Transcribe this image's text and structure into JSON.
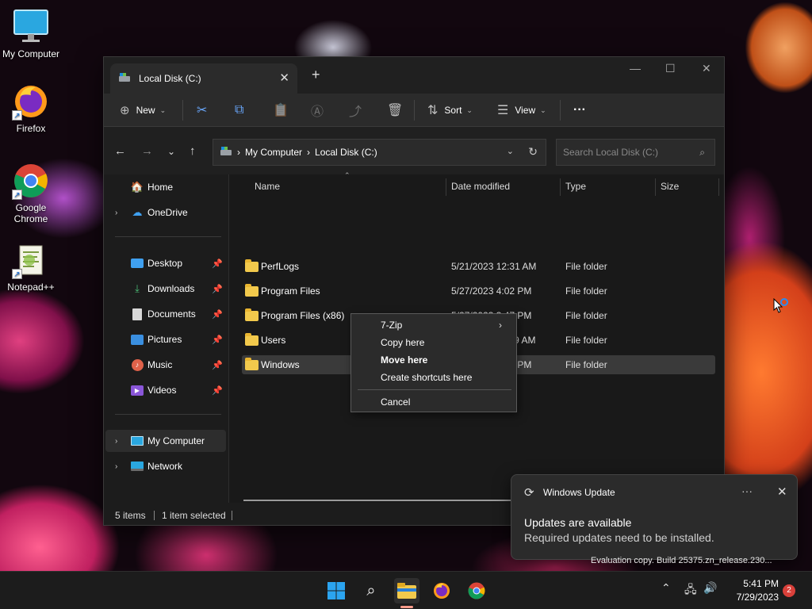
{
  "desktop": {
    "icons": [
      {
        "label": "My Computer",
        "icon": "monitor-icon"
      },
      {
        "label": "Firefox",
        "icon": "firefox-icon"
      },
      {
        "label": "Google Chrome",
        "icon": "chrome-icon"
      },
      {
        "label": "Notepad++",
        "icon": "notepadpp-icon"
      }
    ],
    "watermark": "Evaluation copy. Build 25375.zn_release.230..."
  },
  "explorer": {
    "tab_title": "Local Disk (C:)",
    "toolbar": {
      "new": "New",
      "sort": "Sort",
      "view": "View",
      "more": "···"
    },
    "address": {
      "root": "My Computer",
      "current": "Local Disk (C:)"
    },
    "search_placeholder": "Search Local Disk (C:)",
    "sidebar": [
      {
        "label": "Home",
        "icon": "home-icon",
        "chevron": false,
        "pinned": false
      },
      {
        "label": "OneDrive",
        "icon": "cloud-icon",
        "chevron": true,
        "pinned": false
      },
      {
        "label": "Desktop",
        "icon": "desktop-icon",
        "chevron": false,
        "pinned": true
      },
      {
        "label": "Downloads",
        "icon": "download-icon",
        "chevron": false,
        "pinned": true
      },
      {
        "label": "Documents",
        "icon": "document-icon",
        "chevron": false,
        "pinned": true
      },
      {
        "label": "Pictures",
        "icon": "picture-icon",
        "chevron": false,
        "pinned": true
      },
      {
        "label": "Music",
        "icon": "music-icon",
        "chevron": false,
        "pinned": true
      },
      {
        "label": "Videos",
        "icon": "video-icon",
        "chevron": false,
        "pinned": true
      },
      {
        "label": "My Computer",
        "icon": "computer-icon",
        "chevron": true,
        "pinned": false,
        "selected": true
      },
      {
        "label": "Network",
        "icon": "network-icon",
        "chevron": true,
        "pinned": false
      }
    ],
    "columns": [
      "Name",
      "Date modified",
      "Type",
      "Size"
    ],
    "files": [
      {
        "name": "PerfLogs",
        "date": "5/21/2023 12:31 AM",
        "type": "File folder"
      },
      {
        "name": "Program Files",
        "date": "5/27/2023 4:02 PM",
        "type": "File folder"
      },
      {
        "name": "Program Files (x86)",
        "date": "5/27/2023 3:47 PM",
        "type": "File folder"
      },
      {
        "name": "Users",
        "date": "5/27/2023 11:29 AM",
        "type": "File folder"
      },
      {
        "name": "Windows",
        "date": "5/27/2023 1:22 PM",
        "type": "File folder",
        "selected": true
      }
    ],
    "status": {
      "items": "5 items",
      "selected": "1 item selected"
    }
  },
  "context_menu": {
    "items": [
      {
        "label": "7-Zip",
        "submenu": true
      },
      {
        "label": "Copy here"
      },
      {
        "label": "Move here",
        "bold": true
      },
      {
        "label": "Create shortcuts here"
      },
      {
        "label": "Cancel"
      }
    ]
  },
  "notification": {
    "app": "Windows Update",
    "heading": "Updates are available",
    "body": "Required updates need to be installed."
  },
  "taskbar": {
    "time": "5:41 PM",
    "date": "7/29/2023",
    "badge": "2",
    "accent": "#0078d4"
  }
}
